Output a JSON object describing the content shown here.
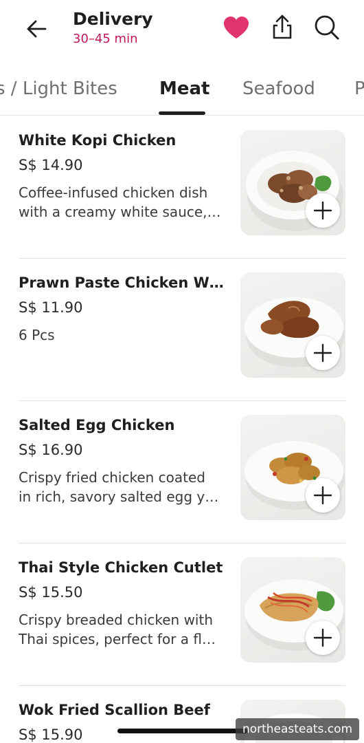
{
  "header": {
    "title": "Delivery",
    "subtitle": "30–45 min"
  },
  "tabs": [
    {
      "label": "s / Light Bites",
      "active": false
    },
    {
      "label": "Meat",
      "active": true
    },
    {
      "label": "Seafood",
      "active": false
    },
    {
      "label": "P",
      "active": false
    }
  ],
  "items": [
    {
      "name": "White Kopi Chicken",
      "price": "S$ 14.90",
      "desc": [
        "Coffee-infused chicken dish",
        "with a creamy white sauce,…"
      ],
      "image": "plate-kopi-chicken"
    },
    {
      "name": "Prawn Paste Chicken Wi…",
      "price": "S$ 11.90",
      "desc": [
        "6 Pcs"
      ],
      "image": "plate-chicken-wings"
    },
    {
      "name": "Salted Egg Chicken",
      "price": "S$ 16.90",
      "desc": [
        "Crispy fried chicken coated",
        "in rich, savory salted egg y…"
      ],
      "image": "plate-salted-egg-chicken"
    },
    {
      "name": "Thai Style Chicken Cutlet",
      "price": "S$ 15.50",
      "desc": [
        "Crispy breaded chicken with",
        "Thai spices, perfect for a fl…"
      ],
      "image": "plate-chicken-cutlet"
    },
    {
      "name": "Wok Fried Scallion Beef",
      "price": "S$ 15.90",
      "desc": [],
      "image": "plate-scallion-beef"
    }
  ],
  "watermark": "northeasteats.com",
  "colors": {
    "accent": "#c2185b",
    "heart": "#e0336f",
    "text": "#1f1f1f"
  },
  "icons": {
    "back": "arrow-left-icon",
    "favorite": "heart-icon",
    "share": "share-icon",
    "search": "search-icon",
    "add": "plus-icon"
  }
}
